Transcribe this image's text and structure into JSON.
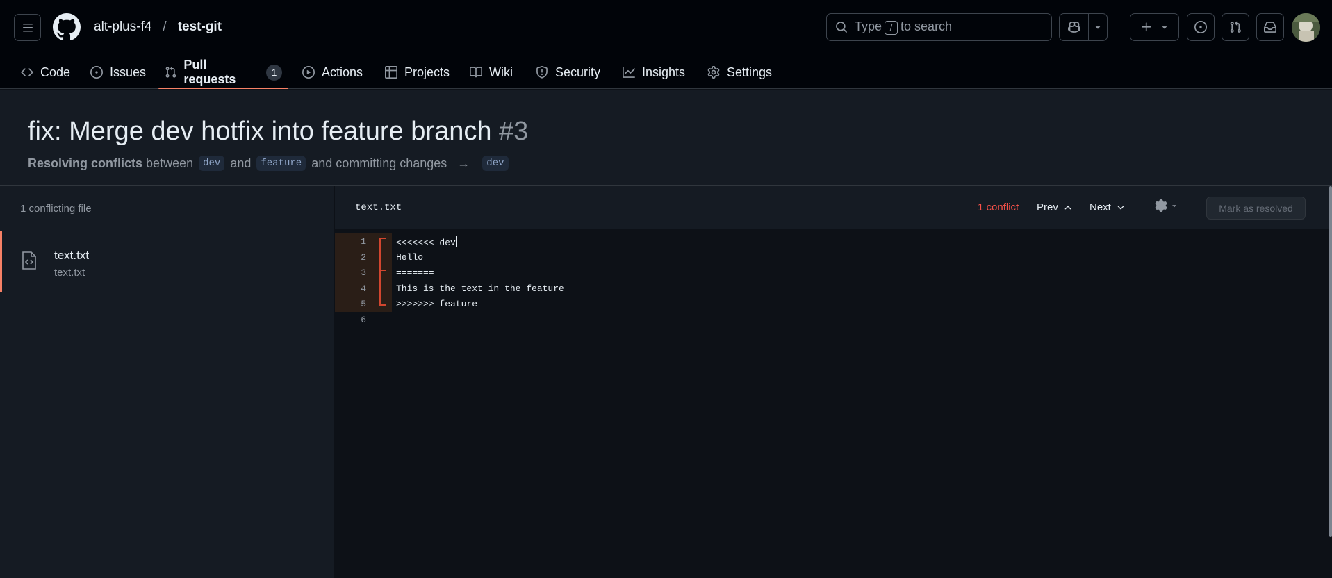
{
  "header": {
    "owner": "alt-plus-f4",
    "separator": "/",
    "repo": "test-git",
    "search": {
      "prefix": "Type",
      "key": "/",
      "suffix": "to search"
    }
  },
  "tabs": [
    {
      "label": "Code",
      "icon": "code-icon"
    },
    {
      "label": "Issues",
      "icon": "issue-icon"
    },
    {
      "label": "Pull requests",
      "icon": "pull-request-icon",
      "count": "1",
      "active": true
    },
    {
      "label": "Actions",
      "icon": "play-icon"
    },
    {
      "label": "Projects",
      "icon": "table-icon"
    },
    {
      "label": "Wiki",
      "icon": "book-icon"
    },
    {
      "label": "Security",
      "icon": "shield-icon"
    },
    {
      "label": "Insights",
      "icon": "graph-icon"
    },
    {
      "label": "Settings",
      "icon": "gear-icon"
    }
  ],
  "pr": {
    "title": "fix: Merge dev hotfix into feature branch",
    "number": "#3",
    "status": "Resolving conflicts",
    "between": "between",
    "base": "dev",
    "and": "and",
    "head": "feature",
    "committing": "and committing changes",
    "arrow": "→",
    "target": "dev"
  },
  "sidebar": {
    "heading": "1 conflicting file",
    "files": [
      {
        "name": "text.txt",
        "path": "text.txt"
      }
    ]
  },
  "editor": {
    "filename": "text.txt",
    "conflicts": "1 conflict",
    "prev": "Prev",
    "next": "Next",
    "resolve": "Mark as resolved",
    "lines": [
      {
        "n": "1",
        "text": "<<<<<<< dev"
      },
      {
        "n": "2",
        "text": "Hello"
      },
      {
        "n": "3",
        "text": "======="
      },
      {
        "n": "4",
        "text": "This is the text in the feature"
      },
      {
        "n": "5",
        "text": ">>>>>>> feature"
      },
      {
        "n": "6",
        "text": ""
      }
    ]
  },
  "colors": {
    "accent": "#f78166",
    "conflict": "#f85149",
    "background": "#0d1117"
  }
}
